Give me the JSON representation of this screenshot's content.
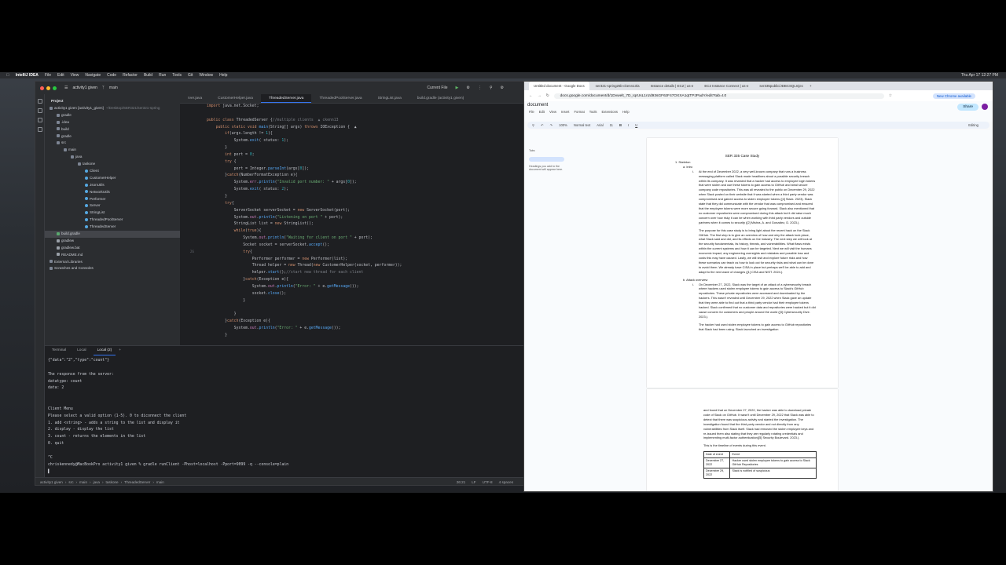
{
  "menubar": {
    "app": "IntelliJ IDEA",
    "items": [
      "File",
      "Edit",
      "View",
      "Navigate",
      "Code",
      "Refactor",
      "Build",
      "Run",
      "Tools",
      "Git",
      "Window",
      "Help"
    ],
    "clock": "Thu Apr 17 12:27 PM"
  },
  "ide": {
    "project_name": "activity1 given",
    "branch": "main",
    "run_config": "Current File",
    "project_panel_title": "Project",
    "tree": [
      {
        "label": "activity1 given [activity1_given]",
        "hint": "~/Desktop/SER321/ser321-spring",
        "depth": 0,
        "icon": "folder"
      },
      {
        "label": "gradle",
        "depth": 1,
        "icon": "folder"
      },
      {
        "label": ".idea",
        "depth": 1,
        "icon": "folder"
      },
      {
        "label": "build",
        "depth": 1,
        "icon": "folder"
      },
      {
        "label": "gradle",
        "depth": 1,
        "icon": "folder"
      },
      {
        "label": "src",
        "depth": 1,
        "icon": "folder"
      },
      {
        "label": "main",
        "depth": 2,
        "icon": "folder"
      },
      {
        "label": "java",
        "depth": 3,
        "icon": "folder"
      },
      {
        "label": "taskone",
        "depth": 4,
        "icon": "folder"
      },
      {
        "label": "Client",
        "depth": 5,
        "icon": "java"
      },
      {
        "label": "CustomerHelper",
        "depth": 5,
        "icon": "java"
      },
      {
        "label": "JsonUtils",
        "depth": 5,
        "icon": "java"
      },
      {
        "label": "NetworkUtils",
        "depth": 5,
        "icon": "java"
      },
      {
        "label": "Performer",
        "depth": 5,
        "icon": "java"
      },
      {
        "label": "Server",
        "depth": 5,
        "icon": "java"
      },
      {
        "label": "StringList",
        "depth": 5,
        "icon": "java"
      },
      {
        "label": "ThreadedPoolServer",
        "depth": 5,
        "icon": "java"
      },
      {
        "label": "ThreadedServer",
        "depth": 5,
        "icon": "java"
      },
      {
        "label": "build.gradle",
        "depth": 1,
        "icon": "gradle",
        "selected": true
      },
      {
        "label": "gradlew",
        "depth": 1,
        "icon": "file"
      },
      {
        "label": "gradlew.bat",
        "depth": 1,
        "icon": "file"
      },
      {
        "label": "README.md",
        "depth": 1,
        "icon": "file"
      },
      {
        "label": "External Libraries",
        "depth": 0,
        "icon": "folder"
      },
      {
        "label": "Scratches and Consoles",
        "depth": 0,
        "icon": "folder"
      }
    ],
    "tabs": [
      {
        "label": "rver.java",
        "active": false
      },
      {
        "label": "CustomerHelper.java",
        "active": false
      },
      {
        "label": "ThreadedServer.java",
        "active": true
      },
      {
        "label": "ThreadedPoolServer.java",
        "active": false
      },
      {
        "label": "StringList.java",
        "active": false
      },
      {
        "label": "build.gradle (activity1 given)",
        "active": false
      }
    ],
    "line_numbers": [
      "",
      "",
      "",
      "",
      "",
      "",
      "",
      "",
      "",
      "",
      "",
      "",
      "",
      "",
      "",
      "",
      "",
      "",
      "",
      "",
      "",
      "26",
      "",
      "",
      "",
      "",
      "",
      "",
      "",
      "",
      "",
      "",
      "",
      "",
      ""
    ],
    "code_lines": [
      "import java.net.Socket;",
      "",
      "public class ThreadedServer {//multiple clients  ▲ ckenn13",
      "    public static void main(String[] args) throws IOException {  ▲ ckenn13",
      "        if(args.length != 1){",
      "            System.exit( status: 1);",
      "        }",
      "        int port = 0;",
      "        try {",
      "            port = Integer.parseInt(args[0]);",
      "        }catch(NumberFormatException e){",
      "            System.err.println(\"Invalid port number: \" + args[0]);",
      "            System.exit( status: 2);",
      "        }",
      "        try{",
      "            ServerSocket serverSocket = new ServerSocket(port);",
      "            System.out.println(\"Listening on port \" + port);",
      "            StringList list = new StringList();",
      "            while(true){",
      "                System.out.println(\"Waiting for client on port \" + port);",
      "                Socket socket = serverSocket.accept();",
      "                try{",
      "                    Performer performer = new Performer(list);",
      "                    Thread helper = new Thread(new CustomerHelper(socket, performer));",
      "                    helper.start();//start new thread for each client",
      "                }catch(Exception e){",
      "                    System.out.println(\"Error: \" + e.getMessage());",
      "                    socket.close();",
      "                }",
      "",
      "            }",
      "        }catch(Exception e){",
      "            System.out.println(\"Error: \" + e.getMessage());",
      "        }"
    ],
    "terminal_tabs": [
      "Terminal",
      "Local",
      "Local (2)"
    ],
    "terminal_lines": [
      "{\"data\":\"2\",\"type\":\"count\"}",
      "",
      "The response from the server:",
      "datatype: count",
      "data: 2",
      "",
      "",
      "Client Menu",
      "Please select a valid option (1-5). 0 to diconnect the client",
      "1. add <string> - adds a string to the list and display it",
      "2. display - display the list",
      "3. count - returns the elements in the list",
      "0. quit",
      "",
      "^C",
      "chriskennedy@MacBookPro activity1 given % gradle runClient -Phost=localhost -Pport=9099 -q --console=plain",
      "▌"
    ],
    "status_path": [
      "activity1 given",
      "src",
      "main",
      "java",
      "taskone",
      "ThreadedServer",
      "main"
    ],
    "status_right": [
      "26:21",
      "LF",
      "UTF-8",
      "4 spaces"
    ]
  },
  "browser": {
    "tabs": [
      {
        "label": "Untitled document - Google Docs",
        "active": true
      },
      {
        "label": "ser321-spring25b-ckenn13/a",
        "active": false
      },
      {
        "label": "Instance details | EC2 | us-e",
        "active": false
      },
      {
        "label": "EC2 Instance Connect | us-e",
        "active": false
      },
      {
        "label": "ser335public/JDBCSQLInjec",
        "active": false
      }
    ],
    "url": "docs.google.com/document/d/1Dvwelt_7D_IqrUsL1nzd93sGF6zF47OXXA1qtTPJPadY/edit?tab=t.0",
    "new_chrome": "New Chrome available",
    "doc_title": "document",
    "doc_menus": [
      "File",
      "Edit",
      "View",
      "Insert",
      "Format",
      "Tools",
      "Extensions",
      "Help"
    ],
    "share_label": "Share",
    "avatar_letter": "C",
    "toolbar": {
      "zoom": "100%",
      "style": "Normal text",
      "font": "Arial",
      "size": "11",
      "mode": "Editing"
    },
    "outline_label": "Tabs",
    "outline_hint": "Headings you add to the document will appear here.",
    "page1": {
      "title": "SER 335 Case Study",
      "list1": "1.   Skeleton",
      "list2": "a.   Intro",
      "list3": "i.",
      "para1": "At the end of December 2022, a very well-known company that runs a business messaging platform called Slack made headlines about a possible security breach within its company. It was revealed that a hacker had access to employee login tokens that were stolen and use these tokens to gain access to GitHub and steal secure company code repositories. This was all revealed to the public on December 29, 2022 when Slack posted on their website that it was started when a third party vendor was compromised and gained access to stolen employee tokens ([4] Slack. 2023). Slack state that they did communicate with the vendor that was compromised and ensured that the employee tokens were more secure going forward. Slack also mentioned that no customer repositories were compromised during this attack but it did raise much concern over how risky it can be when working with third party vendors and outside partners when it comes to security ([2] Mishra, A. and González, D. 2023.).",
      "para2": "The purpose for this case study is to bring light about the recent hack on the Slack GitHub. The first step is to give an overview of how and why the attack took place, what Slack said and did, and its effects on the industry. The next step we will look at the security fundamentals, its history, threats, and vulnerabilities. What flaws exists within the current systems and how it can be targeted. Next we will visit the humans economic impact, any engineering oversights and mistakes and possible loss and costs this may have caused. Lastly, we will visit and explore future risks and how these scenarios can teach us how to look out for security risks and what can be done to avoid them. We already have CISA in place but perhaps we'll be able to add and adapt to the next wave of changes ([1] CISA and NIST. 2024.).",
      "list4": "b.   Attack overview",
      "list5": "i.",
      "para3": "On December 27, 2022, Slack was the target of an attack of a cybersecurity breach where hackers used stolen employee tokens to gain access to Slack's GitHub repositories. These private repositories were accessed and downloaded by the hackers. This wasn't revealed until December 29, 2022 when Slack gave an update that they were able to find out that a third party vendor had their employee tokens hacked. Slack confirmed that no customer data and repositories were hacked but it did cause concern for customers and people around the world ([3] Cybersecurity Dive. 2023.).",
      "para4": "The hacker had used stolen employee tokens to gain access to GitHub repositories that Slack had been using. Slack launched an investigation"
    },
    "page2": {
      "para1": "and found that on December 27, 2022, the hacker was able to download private code of Slack on GitHub. It wasn't until December 29, 2022 that Slack was able to detect that there was suspicious activity and started the investigation. The investigation found that the third party vendor and not directly from any vulnerabilities from Slack itself. Slack had removed the stolen employee keys and re-issued them also stating that they are regularly rotating credentials and implementing multi-factor authentication([5] Security Boulevard. 2023.).",
      "para2": "This is the timeline of events during this event.",
      "table_headers": [
        "Date of event",
        "Event"
      ],
      "table_rows": [
        [
          "December 27, 2022",
          "Hacker used stolen employee tokens to gain access to Slack GitHub Repositories"
        ],
        [
          "December 29, 2022",
          "Slack is notified of suspicious"
        ]
      ]
    }
  },
  "colors": {
    "ide_bg": "#1e1f22",
    "ide_panel": "#2b2d30",
    "accent": "#3574f0",
    "docs_bg": "#f9fbfd"
  }
}
